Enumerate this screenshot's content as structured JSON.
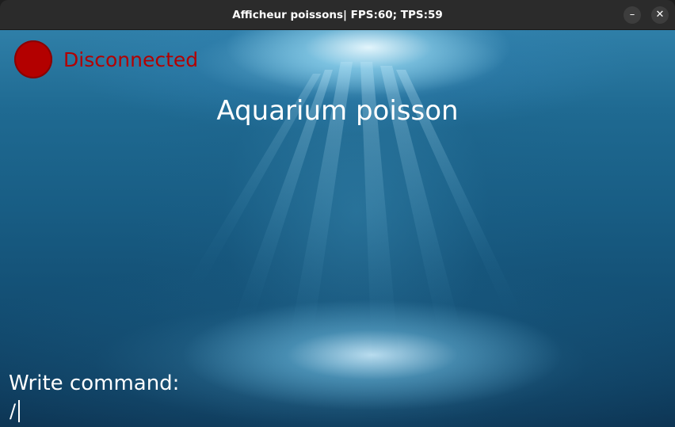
{
  "window": {
    "title": "Afficheur poissons| FPS:60; TPS:59",
    "minimize_glyph": "–",
    "close_glyph": "✕"
  },
  "status": {
    "label": "Disconnected",
    "color": "#b30000"
  },
  "app": {
    "title": "Aquarium poisson"
  },
  "command": {
    "label": "Write command:",
    "prefix": "/",
    "value": ""
  },
  "colors": {
    "titlebar": "#2b2b2b",
    "water_top": "#2f7fa8",
    "water_bottom": "#0d3554",
    "text": "#ffffff"
  }
}
